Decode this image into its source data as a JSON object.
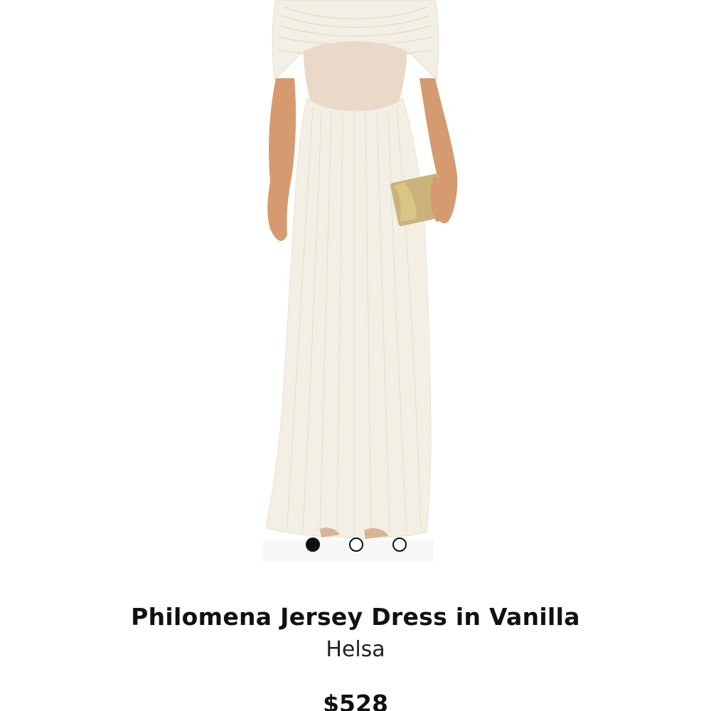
{
  "product": {
    "title": "Philomena Jersey Dress in Vanilla",
    "brand": "Helsa",
    "price": "$528",
    "image_alt": "Model wearing an ivory off-shoulder draped jersey maxi dress with sheer bodice, holding a gold clutch"
  },
  "carousel": {
    "total_slides": 3,
    "active_slide": 1
  },
  "colors": {
    "dress": "#f4efe4",
    "sheer_panel": "#ead8c9",
    "skin": "#d59a6f",
    "clutch": "#c9b37a",
    "text": "#111111"
  }
}
